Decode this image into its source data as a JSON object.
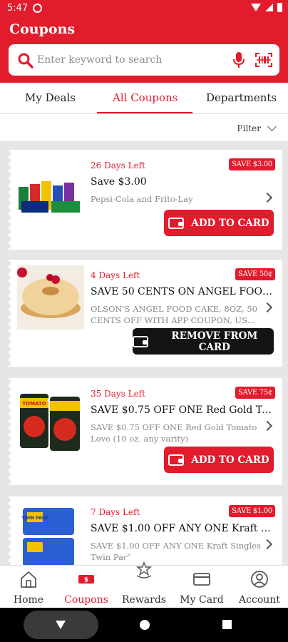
{
  "status": {
    "time": "5:47"
  },
  "app": {
    "title": "Coupons"
  },
  "search": {
    "placeholder": "Enter keyword to search"
  },
  "tabs": [
    {
      "label": "My Deals",
      "active": false
    },
    {
      "label": "All Coupons",
      "active": true
    },
    {
      "label": "Departments",
      "active": false
    }
  ],
  "filter": {
    "label": "Filter"
  },
  "coupons": [
    {
      "days_left": "26 Days Left",
      "badge": "SAVE $3.00",
      "title": "Save $3.00",
      "description": "Pepsi-Cola and Frito-Lay",
      "button": "ADD TO CARD"
    },
    {
      "days_left": "4 Days Left",
      "badge": "SAVE 50¢",
      "title": "SAVE 50 CENTS ON ANGEL FOOD...",
      "description": "OLSON'S ANGEL FOOD CAKE, 8OZ, 50 CENTS OFF WITH APP COUPON, US...",
      "button": "REMOVE FROM CARD"
    },
    {
      "days_left": "35 Days Left",
      "badge": "SAVE 75¢",
      "title": "SAVE $0.75 OFF ONE Red Gold To...",
      "description": "SAVE $0.75 OFF ONE Red Gold Tomato Love (10 oz. any varity)",
      "button": "ADD TO CARD"
    },
    {
      "days_left": "7 Days Left",
      "badge": "SAVE $1.00",
      "title": "SAVE $1.00 OFF ANY ONE Kraft Si...",
      "description": "SAVE $1.00 OFF ANY ONE Kraft Singles Twin Pack...",
      "button": ""
    }
  ],
  "product_labels": {
    "can_label": "TOMATO",
    "pack_label": "TWIN PACK"
  },
  "nav": [
    {
      "label": "Home"
    },
    {
      "label": "Coupons",
      "badge": "$"
    },
    {
      "label": "Rewards"
    },
    {
      "label": "My Card"
    },
    {
      "label": "Account"
    }
  ],
  "colors": {
    "brand": "#e21b2d",
    "dark_button": "#141414"
  }
}
